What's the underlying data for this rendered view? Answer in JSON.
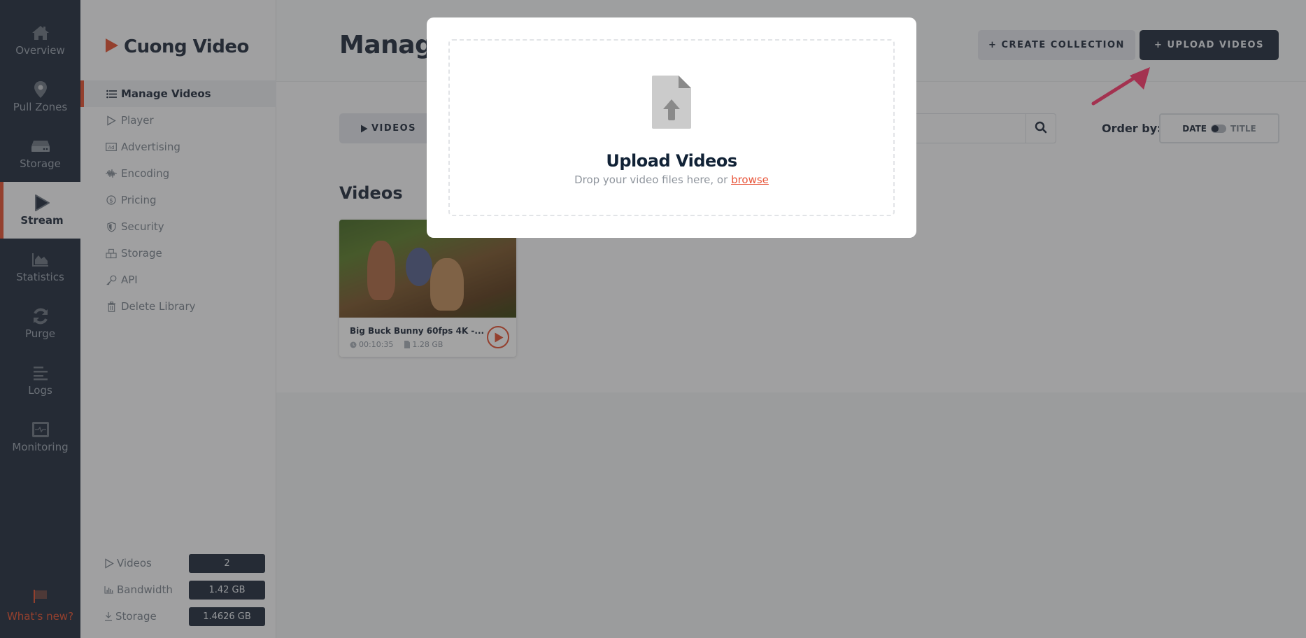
{
  "rail": {
    "items": [
      {
        "label": "Overview",
        "icon": "home-icon"
      },
      {
        "label": "Pull Zones",
        "icon": "map-pin-icon"
      },
      {
        "label": "Storage",
        "icon": "hard-drive-icon"
      },
      {
        "label": "Stream",
        "icon": "play-icon",
        "active": true
      },
      {
        "label": "Statistics",
        "icon": "area-chart-icon"
      },
      {
        "label": "Purge",
        "icon": "refresh-icon"
      },
      {
        "label": "Logs",
        "icon": "logs-icon"
      },
      {
        "label": "Monitoring",
        "icon": "monitor-pulse-icon"
      }
    ],
    "whats_new": "What's new?"
  },
  "sidebar": {
    "brand": "Cuong Video",
    "items": [
      {
        "label": "Manage Videos",
        "icon": "list-icon",
        "active": true
      },
      {
        "label": "Player",
        "icon": "play-outline-icon"
      },
      {
        "label": "Advertising",
        "icon": "ad-icon"
      },
      {
        "label": "Encoding",
        "icon": "waveform-icon"
      },
      {
        "label": "Pricing",
        "icon": "dollar-circle-icon"
      },
      {
        "label": "Security",
        "icon": "shield-icon"
      },
      {
        "label": "Storage",
        "icon": "boxes-icon"
      },
      {
        "label": "API",
        "icon": "key-icon"
      },
      {
        "label": "Delete Library",
        "icon": "trash-icon"
      }
    ],
    "stats": [
      {
        "label": "Videos",
        "value": "2",
        "icon": "play-outline-icon"
      },
      {
        "label": "Bandwidth",
        "value": "1.42 GB",
        "icon": "bar-chart-icon"
      },
      {
        "label": "Storage",
        "value": "1.4626 GB",
        "icon": "download-icon"
      }
    ]
  },
  "header": {
    "title": "Manage Videos",
    "create_collection": "+ CREATE COLLECTION",
    "upload_videos": "+ UPLOAD VIDEOS"
  },
  "toolbar": {
    "tab_videos": "VIDEOS",
    "search_placeholder": "",
    "order_by_label": "Order by:",
    "order_date": "DATE",
    "order_title": "TITLE"
  },
  "videos": {
    "section_title": "Videos",
    "items": [
      {
        "title": "Big Buck Bunny 60fps 4K -...",
        "duration": "00:10:35",
        "size": "1.28 GB"
      }
    ]
  },
  "modal": {
    "title": "Upload Videos",
    "subtitle": "Drop your video files here, or",
    "browse_link": "browse"
  },
  "colors": {
    "accent": "#e86448",
    "rail_bg": "#3a4453",
    "annotation_arrow": "#ff4f7e"
  }
}
